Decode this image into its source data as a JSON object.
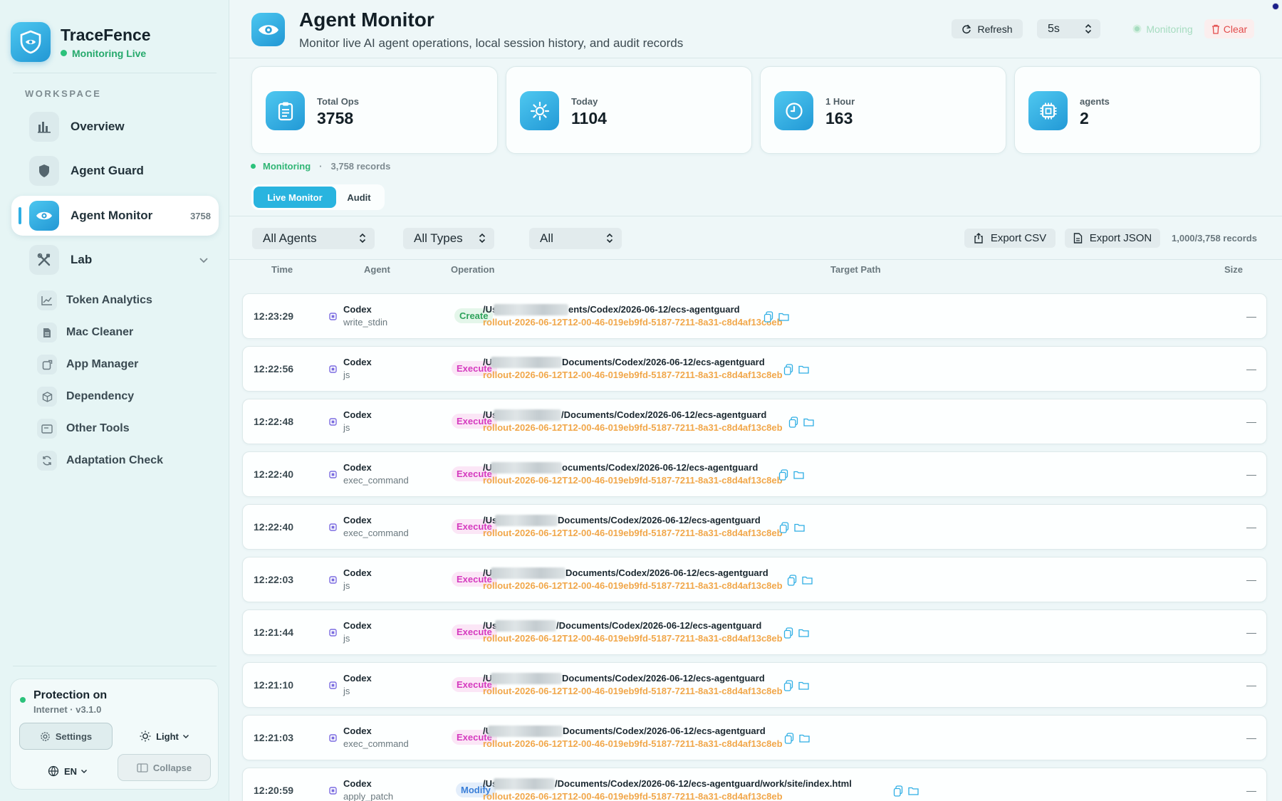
{
  "brand": {
    "name": "TraceFence",
    "status": "Monitoring Live"
  },
  "sidebar": {
    "section_label": "WORKSPACE",
    "nav": [
      {
        "label": "Overview",
        "icon": "bar-chart-icon"
      },
      {
        "label": "Agent Guard",
        "icon": "shield-icon"
      },
      {
        "label": "Agent Monitor",
        "icon": "eye-icon",
        "count": "3758",
        "active": true
      },
      {
        "label": "Lab",
        "icon": "tools-icon"
      }
    ],
    "lab_items": [
      {
        "label": "Token Analytics",
        "icon": "line-chart-icon"
      },
      {
        "label": "Mac Cleaner",
        "icon": "file-icon"
      },
      {
        "label": "App Manager",
        "icon": "app-icon"
      },
      {
        "label": "Dependency",
        "icon": "cube-icon"
      },
      {
        "label": "Other Tools",
        "icon": "terminal-icon"
      },
      {
        "label": "Adaptation Check",
        "icon": "refresh-icon"
      }
    ],
    "protection": {
      "title": "Protection on",
      "subtitle": "Internet · v3.1.0",
      "settings_label": "Settings",
      "theme_label": "Light",
      "lang_label": "EN",
      "collapse_label": "Collapse"
    }
  },
  "header": {
    "title": "Agent Monitor",
    "subtitle": "Monitor live AI agent operations, local session history, and audit records",
    "refresh_label": "Refresh",
    "interval_value": "5s",
    "monitoring_label": "Monitoring",
    "clear_label": "Clear"
  },
  "stats": [
    {
      "label": "Total Ops",
      "value": "3758",
      "icon": "clipboard-icon"
    },
    {
      "label": "Today",
      "value": "1104",
      "icon": "sun-icon"
    },
    {
      "label": "1 Hour",
      "value": "163",
      "icon": "clock-icon"
    },
    {
      "label": "agents",
      "value": "2",
      "icon": "chip-icon"
    }
  ],
  "status_line": {
    "state": "Monitoring",
    "separator": "·",
    "records": "3,758 records"
  },
  "tabs": [
    {
      "label": "Live Monitor",
      "active": true
    },
    {
      "label": "Audit",
      "active": false
    }
  ],
  "filters": {
    "agent": "All Agents",
    "type": "All Types",
    "scope": "All",
    "export_csv": "Export CSV",
    "export_json": "Export JSON",
    "record_count": "1,000/3,758 records"
  },
  "table": {
    "columns": [
      "Time",
      "Agent",
      "Operation",
      "Target Path",
      "Size"
    ],
    "rows": [
      {
        "time": "12:23:29",
        "agent": "Codex",
        "tool": "write_stdin",
        "op": "Create",
        "path_start": "/Users",
        "path_end": "ents/Codex/2026-06-12/ecs-agentguard",
        "file": "rollout-2026-06-12T12-00-46-019eb9fd-5187-7211-8a31-c8d4af13c8eb",
        "size": "—"
      },
      {
        "time": "12:22:56",
        "agent": "Codex",
        "tool": "js",
        "op": "Execute",
        "path_start": "/User",
        "path_end": "Documents/Codex/2026-06-12/ecs-agentguard",
        "file": "rollout-2026-06-12T12-00-46-019eb9fd-5187-7211-8a31-c8d4af13c8eb",
        "size": "—"
      },
      {
        "time": "12:22:48",
        "agent": "Codex",
        "tool": "js",
        "op": "Execute",
        "path_start": "/User.",
        "path_end": "/Documents/Codex/2026-06-12/ecs-agentguard",
        "file": "rollout-2026-06-12T12-00-46-019eb9fd-5187-7211-8a31-c8d4af13c8eb",
        "size": "—"
      },
      {
        "time": "12:22:40",
        "agent": "Codex",
        "tool": "exec_command",
        "op": "Execute",
        "path_start": "/User",
        "path_end": "ocuments/Codex/2026-06-12/ecs-agentguard",
        "file": "rollout-2026-06-12T12-00-46-019eb9fd-5187-7211-8a31-c8d4af13c8eb",
        "size": "—"
      },
      {
        "time": "12:22:40",
        "agent": "Codex",
        "tool": "exec_command",
        "op": "Execute",
        "path_start": "/Users,",
        "path_end": "Documents/Codex/2026-06-12/ecs-agentguard",
        "file": "rollout-2026-06-12T12-00-46-019eb9fd-5187-7211-8a31-c8d4af13c8eb",
        "size": "—"
      },
      {
        "time": "12:22:03",
        "agent": "Codex",
        "tool": "js",
        "op": "Execute",
        "path_start": "/User",
        "path_end": "Documents/Codex/2026-06-12/ecs-agentguard",
        "file": "rollout-2026-06-12T12-00-46-019eb9fd-5187-7211-8a31-c8d4af13c8eb",
        "size": "—"
      },
      {
        "time": "12:21:44",
        "agent": "Codex",
        "tool": "js",
        "op": "Execute",
        "path_start": "/Users",
        "path_end": "/Documents/Codex/2026-06-12/ecs-agentguard",
        "file": "rollout-2026-06-12T12-00-46-019eb9fd-5187-7211-8a31-c8d4af13c8eb",
        "size": "—"
      },
      {
        "time": "12:21:10",
        "agent": "Codex",
        "tool": "js",
        "op": "Execute",
        "path_start": "/User",
        "path_end": "Documents/Codex/2026-06-12/ecs-agentguard",
        "file": "rollout-2026-06-12T12-00-46-019eb9fd-5187-7211-8a31-c8d4af13c8eb",
        "size": "—"
      },
      {
        "time": "12:21:03",
        "agent": "Codex",
        "tool": "exec_command",
        "op": "Execute",
        "path_start": "/Use",
        "path_end": "Documents/Codex/2026-06-12/ecs-agentguard",
        "file": "rollout-2026-06-12T12-00-46-019eb9fd-5187-7211-8a31-c8d4af13c8eb",
        "size": "—"
      },
      {
        "time": "12:20:59",
        "agent": "Codex",
        "tool": "apply_patch",
        "op": "Modify",
        "path_start": "/User",
        "path_end": "/Documents/Codex/2026-06-12/ecs-agentguard/work/site/index.html",
        "file": "rollout-2026-06-12T12-00-46-019eb9fd-5187-7211-8a31-c8d4af13c8eb",
        "size": "—"
      }
    ]
  },
  "colors": {
    "accent": "#29b4df",
    "live": "#2bc27b",
    "create": "#2ea35b",
    "execute": "#d53abf",
    "modify": "#3a7fd8",
    "file_path": "#f1a74a",
    "danger": "#e24b4b"
  }
}
